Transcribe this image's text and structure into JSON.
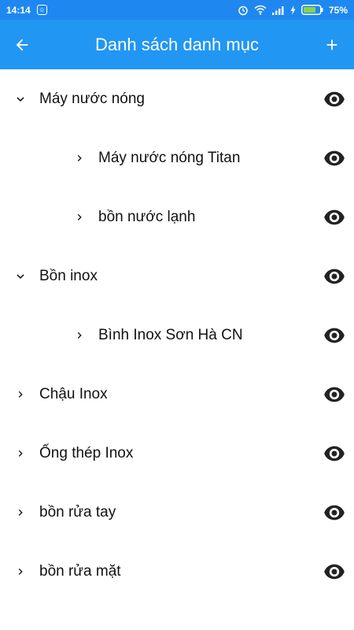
{
  "status_bar": {
    "time": "14:14",
    "notification_icon": "android-notification-icon",
    "battery_percent": "75%"
  },
  "app_bar": {
    "title": "Danh sách danh mục",
    "back_icon": "arrow-back-icon",
    "add_icon": "plus-icon"
  },
  "categories": [
    {
      "label": "Máy nước nóng",
      "level": 0,
      "expanded": true
    },
    {
      "label": "Máy nước nóng Titan",
      "level": 1,
      "expanded": false
    },
    {
      "label": "bồn nước lạnh",
      "level": 1,
      "expanded": false
    },
    {
      "label": "Bồn inox",
      "level": 0,
      "expanded": true
    },
    {
      "label": "Bình Inox Sơn Hà CN",
      "level": 1,
      "expanded": false
    },
    {
      "label": "Chậu Inox",
      "level": 0,
      "expanded": false
    },
    {
      "label": "Ống thép Inox",
      "level": 0,
      "expanded": false
    },
    {
      "label": "bồn rửa tay",
      "level": 0,
      "expanded": false
    },
    {
      "label": "bồn rửa mặt",
      "level": 0,
      "expanded": false
    }
  ],
  "colors": {
    "status_bar": "#1e88f0",
    "app_bar": "#2196f3",
    "text": "#111111",
    "icon": "#222222"
  }
}
